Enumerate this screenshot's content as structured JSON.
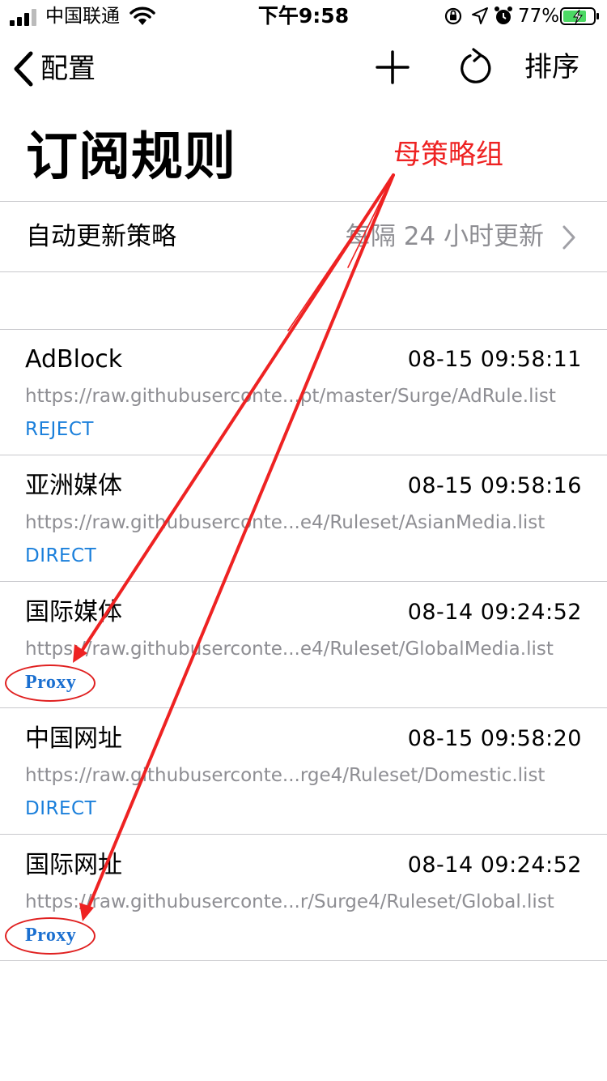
{
  "status_bar": {
    "carrier": "中国联通",
    "time": "下午9:58",
    "battery_percent": "77%",
    "icons": [
      "signal-icon",
      "wifi-icon",
      "rotation-lock-icon",
      "location-icon",
      "alarm-icon",
      "battery-charging-icon"
    ]
  },
  "nav": {
    "back_label": "配置",
    "sort_label": "排序",
    "icons": [
      "chevron-left-icon",
      "plus-icon",
      "refresh-icon"
    ]
  },
  "page": {
    "title": "订阅规则"
  },
  "annotation": {
    "label": "母策略组",
    "color": "#ee2222"
  },
  "auto_update": {
    "label": "自动更新策略",
    "value": "每隔 24 小时更新"
  },
  "subscriptions": [
    {
      "name": "AdBlock",
      "time": "08-15 09:58:11",
      "url": "https://raw.githubuserconte...pt/master/Surge/AdRule.list",
      "policy": "REJECT"
    },
    {
      "name": "亚洲媒体",
      "time": "08-15 09:58:16",
      "url": "https://raw.githubuserconte...e4/Ruleset/AsianMedia.list",
      "policy": "DIRECT"
    },
    {
      "name": "国际媒体",
      "time": "08-14 09:24:52",
      "url": "https://raw.githubuserconte...e4/Ruleset/GlobalMedia.list",
      "policy": "Proxy"
    },
    {
      "name": "中国网址",
      "time": "08-15 09:58:20",
      "url": "https://raw.githubuserconte...rge4/Ruleset/Domestic.list",
      "policy": "DIRECT"
    },
    {
      "name": "国际网址",
      "time": "08-14 09:24:52",
      "url": "https://raw.githubuserconte...r/Surge4/Ruleset/Global.list",
      "policy": "Proxy"
    }
  ],
  "colors": {
    "policy_blue": "#1a7fdb",
    "secondary_gray": "#8e8e93",
    "separator": "#c8c8cc"
  }
}
